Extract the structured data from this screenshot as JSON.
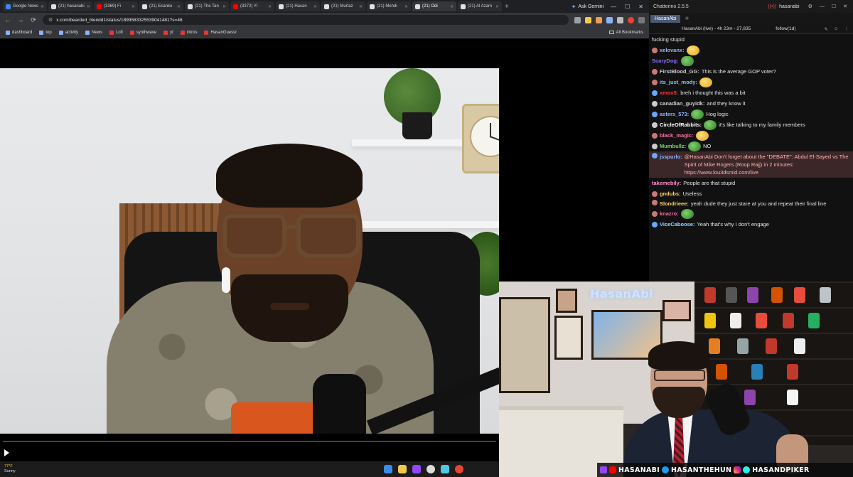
{
  "browser": {
    "tabs": [
      {
        "label": "Google News",
        "color": "#4285f4",
        "active": false
      },
      {
        "label": "(21) hasanabi",
        "color": "#e0e0e0",
        "active": false
      },
      {
        "label": "(3369) Fi",
        "color": "#ff0000",
        "active": false
      },
      {
        "label": "(21) Ecanko",
        "color": "#e0e0e0",
        "active": false
      },
      {
        "label": "(21) The Tan",
        "color": "#e0e0e0",
        "active": false
      },
      {
        "label": "(3372) Yi",
        "color": "#ff0000",
        "active": false
      },
      {
        "label": "(21) Hasan",
        "color": "#e0e0e0",
        "active": false
      },
      {
        "label": "(21) Murtaz",
        "color": "#e0e0e0",
        "active": false
      },
      {
        "label": "(21) Mehdi",
        "color": "#e0e0e0",
        "active": false
      },
      {
        "label": "(21) Odi",
        "color": "#e0e0e0",
        "active": true
      },
      {
        "label": "(21) Al Azam",
        "color": "#e0e0e0",
        "active": false
      }
    ],
    "ask_gemini": "Ask Gemini",
    "url": "x.com/bearded_blendd1/status/1899583325539041481?s=46",
    "bookmarks": [
      {
        "label": "dashboard",
        "red": false
      },
      {
        "label": "top",
        "red": false
      },
      {
        "label": "activity",
        "red": false
      },
      {
        "label": "News",
        "red": false
      },
      {
        "label": "Lofi",
        "red": true
      },
      {
        "label": "synthwave",
        "red": true
      },
      {
        "label": "yt",
        "red": true
      },
      {
        "label": "intros",
        "red": true
      },
      {
        "label": "HasanGuessr",
        "red": true
      }
    ],
    "all_bookmarks": "All Bookmarks",
    "video_progress": 0.0
  },
  "taskbar": {
    "temperature": "77°F",
    "weather": "Sunny"
  },
  "chat": {
    "app_title": "Chatterino 2.5.5",
    "user": "hasanabi",
    "tab_label": "HasanAbi",
    "header_title": "HasanAbi (live) - 4h 23m - 27,835",
    "follow": "follow(1d)",
    "messages": [
      {
        "user": "",
        "user_color": "#e6e6e6",
        "text": "fucking stupid",
        "emote": "",
        "badge": "",
        "highlight": false,
        "wrap": false
      },
      {
        "user": "xelovanx:",
        "user_color": "#8fb7ff",
        "text": "",
        "emote": "yellow",
        "badge": "#c77",
        "highlight": false,
        "wrap": false
      },
      {
        "user": "ScaryDog:",
        "user_color": "#8a6cff",
        "text": "",
        "emote": "wide",
        "badge": "",
        "highlight": false,
        "wrap": false
      },
      {
        "user": "FirstBlood_GG:",
        "user_color": "#cfcfcf",
        "text": "This is the average GOP voter?",
        "emote": "",
        "badge": "#c77",
        "highlight": false,
        "wrap": false
      },
      {
        "user": "its_just_mody:",
        "user_color": "#7fc7ff",
        "text": "",
        "emote": "yellow",
        "badge": "#c77",
        "highlight": false,
        "wrap": false
      },
      {
        "user": "xmox5:",
        "user_color": "#ff3b3b",
        "text": "breh i thought this was a bit",
        "emote": "",
        "badge": "#6aa7ff",
        "highlight": false,
        "wrap": false
      },
      {
        "user": "canadian_guyidk:",
        "user_color": "#cfcfcf",
        "text": "and they know it",
        "emote": "",
        "badge": "#ccc",
        "highlight": false,
        "wrap": false
      },
      {
        "user": "asters_573:",
        "user_color": "#8fb7ff",
        "text": "Hog logic",
        "emote": "green",
        "badge": "#6aa7ff",
        "highlight": false,
        "wrap": false
      },
      {
        "user": "CircleOfRabbits:",
        "user_color": "#ffffff",
        "text": "it's like talking to my family members",
        "emote": "green",
        "badge": "#ccc",
        "highlight": false,
        "wrap": false
      },
      {
        "user": "black_magic:",
        "user_color": "#ff6fa8",
        "text": "",
        "emote": "yellow",
        "badge": "#c77",
        "highlight": false,
        "wrap": false
      },
      {
        "user": "Mumbullz:",
        "user_color": "#7ad36b",
        "text": "NO",
        "emote": "green",
        "badge": "#ccc",
        "highlight": false,
        "wrap": false
      },
      {
        "user": "jsspurlo:",
        "user_color": "#8fb7ff",
        "text": "@HasanAbi Don't forget about the \"DEBATE\": Abdul El-Sayed vs The Spirit of Mike Rogers (Roop Rajj) in 2 minutes: https://www.lou3dsmid.com/live",
        "emote": "",
        "badge": "#6aa7ff",
        "highlight": true,
        "wrap": true
      },
      {
        "user": "takemebily:",
        "user_color": "#ff8fd0",
        "text": "People are that stupid",
        "emote": "",
        "badge": "",
        "highlight": false,
        "wrap": false
      },
      {
        "user": "gndubs:",
        "user_color": "#ffd66b",
        "text": "Useless",
        "emote": "",
        "badge": "#c77",
        "highlight": false,
        "wrap": false
      },
      {
        "user": "Slondrieee:",
        "user_color": "#ffd66b",
        "text": "yeah dude they just stare at you and repeat their final line",
        "emote": "",
        "badge": "#c77",
        "highlight": false,
        "wrap": true
      },
      {
        "user": "knazro:",
        "user_color": "#ff6fa8",
        "text": "",
        "emote": "green",
        "badge": "#c77",
        "highlight": false,
        "wrap": false
      },
      {
        "user": "ViceCaboose:",
        "user_color": "#8fd8ff",
        "text": "Yeah that's why I don't engage",
        "emote": "",
        "badge": "#6aa7ff",
        "highlight": false,
        "wrap": false
      }
    ]
  },
  "webcam": {
    "sign": "HasanAbi",
    "socials": [
      "HASANABI",
      "HASANTHEHUN",
      "HASANDPIKER"
    ]
  },
  "colors": {
    "twitter_blue": "#1d9bf0",
    "chat_bg": "#111111",
    "highlight_bg": "#3b2727"
  }
}
